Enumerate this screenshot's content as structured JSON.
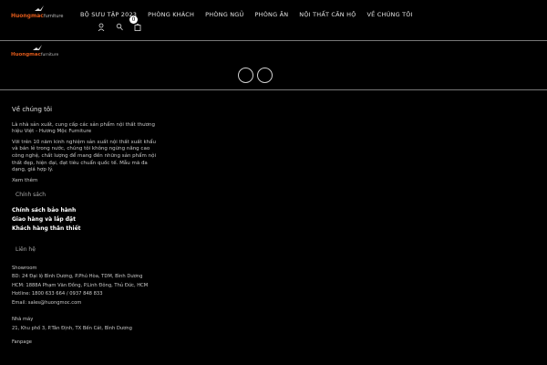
{
  "header": {
    "logo_text": "Huongmac",
    "logo_sub": "furniture",
    "nav": [
      "Bộ sưu tập 2023",
      "Phòng khách",
      "Phòng ngủ",
      "Phòng ăn",
      "Nội thất căn hộ",
      "Về chúng tôi"
    ],
    "icons": [
      "user-icon",
      "search-icon",
      "cart-icon"
    ],
    "cart_count": "0"
  },
  "subbar": {
    "logo_text": "Huongmac",
    "logo_sub": "furniture"
  },
  "footer": {
    "about_title": "Về chúng tôi",
    "about_p1": "Là nhà sản xuất, cung cấp các sản phẩm nội thất thương hiệu Việt - Hương Mộc Furniture",
    "about_p2": "Với trên 10 năm kinh nghiệm sản xuất nội thất xuất khẩu và bán lẻ trong nước, chúng tôi không ngừng nâng cao công nghệ, chất lượng để mang đến những sản phẩm nội thất đẹp, hiện đại, đạt tiêu chuẩn quốc tế. Mẫu mã đa dạng, giá hợp lý.",
    "read_more": "Xem thêm",
    "policy_title": "Chính sách",
    "policies": [
      "Chính sách bảo hành",
      "Giao hàng và lắp đặt",
      "Khách hàng thân thiết"
    ],
    "contact_title": "Liên hệ",
    "showroom_label": "Showroom",
    "showroom_lines": [
      "BD: 24 Đại lộ Bình Dương, P.Phú Hòa, TDM, Bình Dương",
      "HCM: 1888A Phạm Văn Đồng, P.Linh Đông, Thủ Đức, HCM",
      "Hotline: 1800 633 664 / 0937 848 833",
      "Email: sales@huongmoc.com"
    ],
    "factory_label": "Nhà máy",
    "factory_line": "21, Khu phố 3, P.Tân Định, TX Bến Cát, Bình Dương",
    "bottom_text": "Fanpage"
  }
}
